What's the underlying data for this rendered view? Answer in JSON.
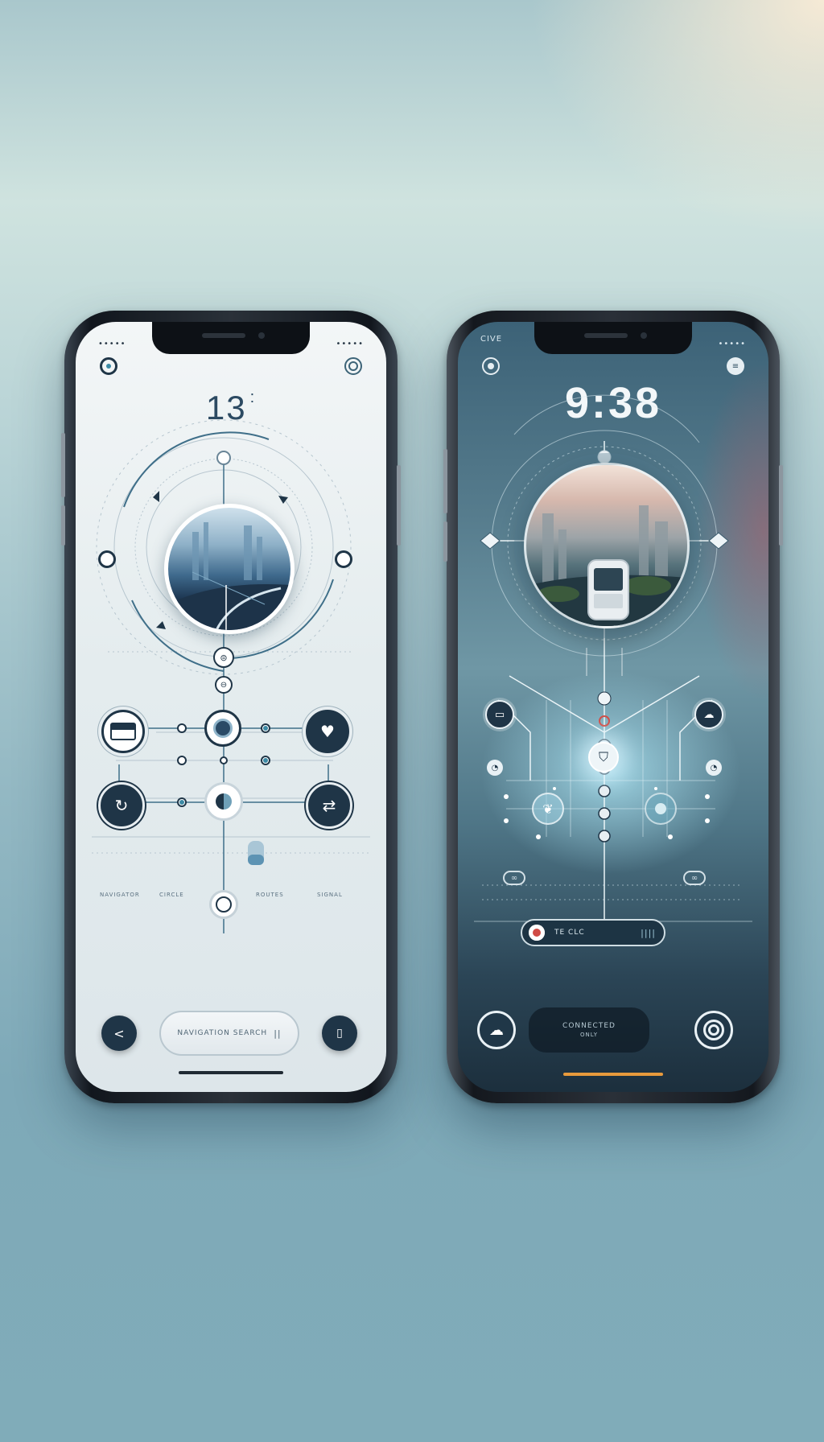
{
  "colors": {
    "background_top": "#cfe3df",
    "background_bottom": "#80acb9",
    "light_screen": "#eef3f5",
    "dark_screen": "#4f7687",
    "navy": "#1f3547",
    "accent_red": "#d04b45",
    "accent_orange": "#e89a3c"
  },
  "light_phone": {
    "status_dots": "••••• ",
    "time": "13",
    "time_suffix": ":",
    "top_left_icon": "target-icon",
    "top_right_icon": "settings-circle-icon",
    "orb_image": "city-road-scene",
    "nodes": {
      "left_upper": "card-icon",
      "center_upper": "lens-icon",
      "right_upper": "pin-heart-icon",
      "left_lower": "refresh-icon",
      "center_lower": "half-moon-icon",
      "right_lower": "swap-icon",
      "bottom_center": "ring-icon"
    },
    "micro_labels": [
      "NAVIGATOR",
      "CIRCLE",
      "ROUTES",
      "SIGNAL"
    ],
    "back_button": "<",
    "search_pill_text": "NAVIGATION SEARCH",
    "search_pill_suffix": "||",
    "menu_button_icon": "document-icon"
  },
  "dark_phone": {
    "carrier": "CIVE",
    "status_dots": "•••••",
    "time": "9:38",
    "top_left_icon": "target-icon",
    "top_right_icon": "list-icon",
    "orb_image": "city-sunset-device",
    "nodes": {
      "left_mid": "screen-icon",
      "right_mid": "cloud-icon",
      "center_glow": "shield-icon",
      "left_glow": "leaf-icon",
      "right_glow": "dial-icon",
      "left_small": "clock-icon",
      "right_small": "clock-icon"
    },
    "left_tag_icon": "chain-icon",
    "right_tag_icon": "chain-icon",
    "control_bar_text": "TE CLC",
    "control_bar_suffix": "||||",
    "bottom_left_icon": "shield-cloud-icon",
    "bottom_right_icon": "ring-icon",
    "bottom_pill_text": "CONNECTED",
    "bottom_pill_sub": "ONLY"
  }
}
